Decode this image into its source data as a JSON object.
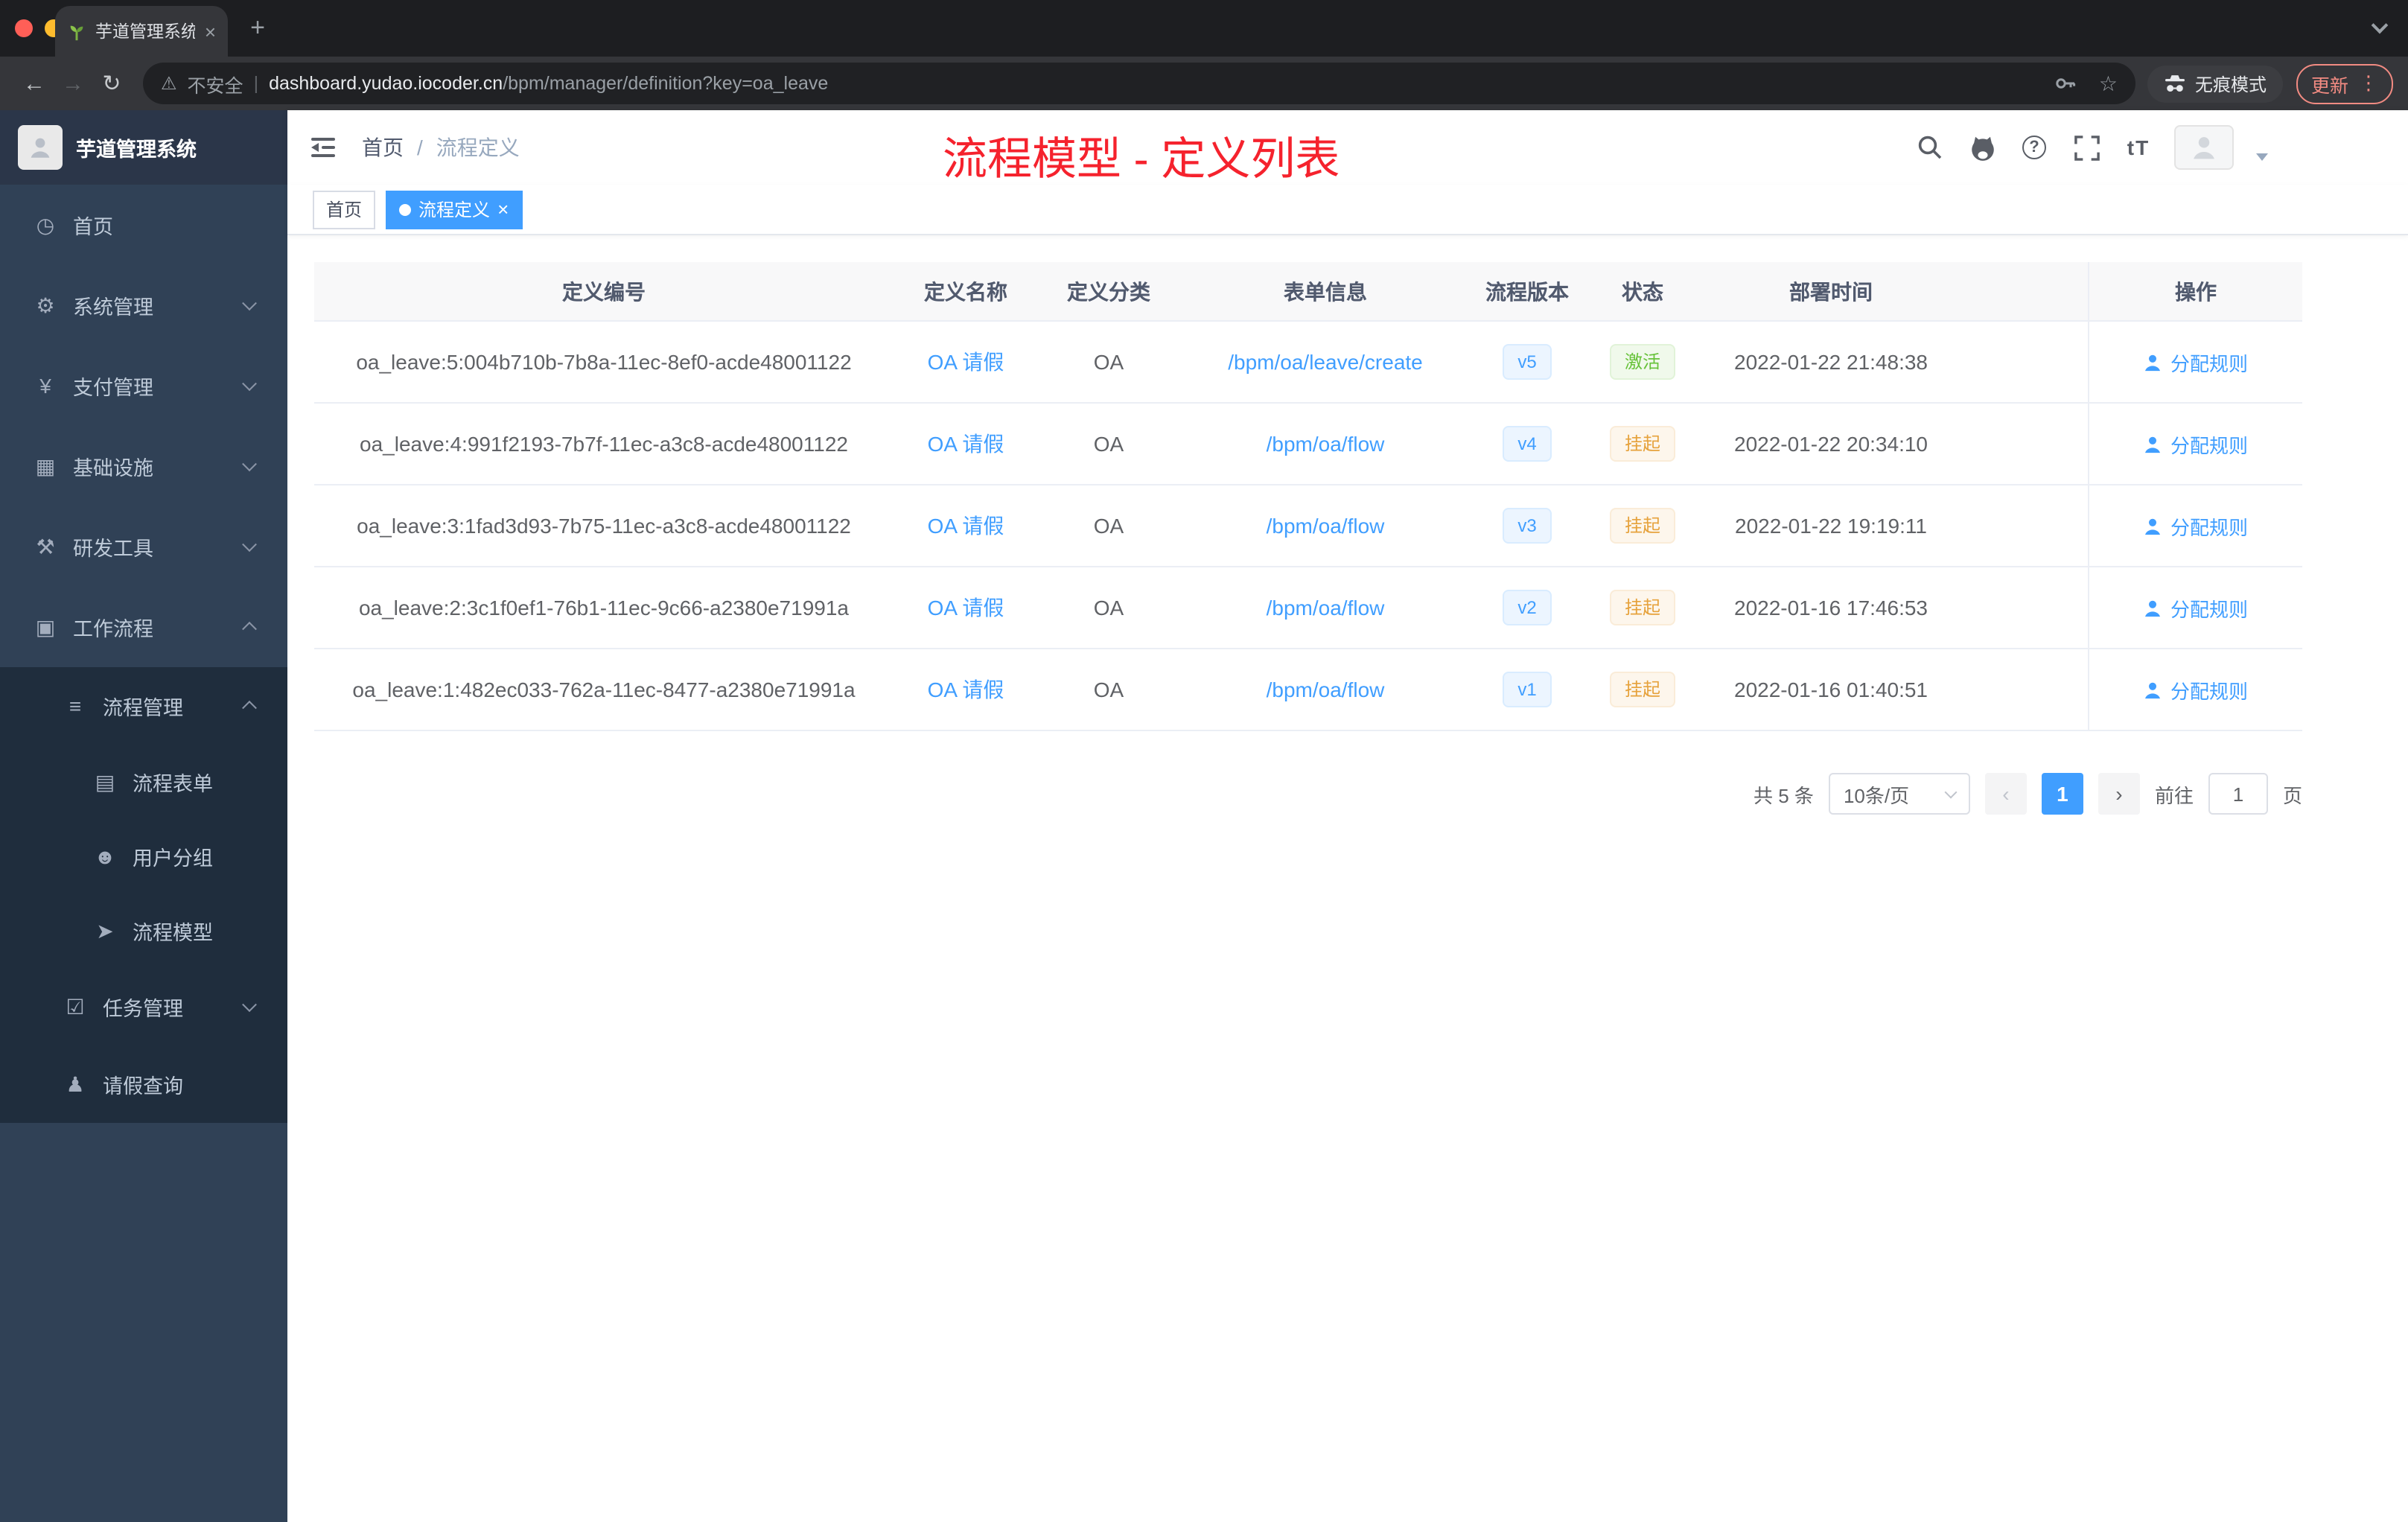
{
  "browser": {
    "tab_title": "芋道管理系统",
    "tab_close_glyph": "×",
    "new_tab_glyph": "+",
    "back_glyph": "←",
    "forward_glyph": "→",
    "reload_glyph": "↻",
    "warning_glyph": "⚠",
    "security_label": "不安全",
    "divider_glyph": "|",
    "url_domain": "dashboard.yudao.iocoder.cn",
    "url_path": "/bpm/manager/definition?key=oa_leave",
    "star_glyph": "☆",
    "incognito_label": "无痕模式",
    "update_label": "更新",
    "menu_dots_glyph": "⋮"
  },
  "sidebar": {
    "logo_title": "芋道管理系统",
    "menu": [
      {
        "label": "首页",
        "glyph": "◷"
      },
      {
        "label": "系统管理",
        "glyph": "⚙"
      },
      {
        "label": "支付管理",
        "glyph": "¥"
      },
      {
        "label": "基础设施",
        "glyph": "▦"
      },
      {
        "label": "研发工具",
        "glyph": "⚒"
      },
      {
        "label": "工作流程",
        "glyph": "▣"
      },
      {
        "label": "流程管理",
        "glyph": "≡"
      },
      {
        "label": "流程表单",
        "glyph": "▤"
      },
      {
        "label": "用户分组",
        "glyph": "☻"
      },
      {
        "label": "流程模型",
        "glyph": "➤"
      },
      {
        "label": "任务管理",
        "glyph": "☑"
      },
      {
        "label": "请假查询",
        "glyph": "♟"
      }
    ]
  },
  "header": {
    "breadcrumb_home": "首页",
    "breadcrumb_sep": "/",
    "breadcrumb_current": "流程定义",
    "font_size_tool": "tT",
    "question_glyph": "?"
  },
  "annotation": {
    "text": "流程模型 - 定义列表",
    "color": "#f5222d"
  },
  "tags": {
    "home": "首页",
    "active": "流程定义",
    "close_glyph": "×"
  },
  "table": {
    "columns": {
      "id": "定义编号",
      "name": "定义名称",
      "category": "定义分类",
      "form": "表单信息",
      "version": "流程版本",
      "status": "状态",
      "deploy_time": "部署时间",
      "action": "操作"
    },
    "rows": [
      {
        "id": "oa_leave:5:004b710b-7b8a-11ec-8ef0-acde48001122",
        "name": "OA 请假",
        "category": "OA",
        "form": "/bpm/oa/leave/create",
        "version": "v5",
        "status": "激活",
        "deploy_time": "2022-01-22 21:48:38",
        "action": "分配规则"
      },
      {
        "id": "oa_leave:4:991f2193-7b7f-11ec-a3c8-acde48001122",
        "name": "OA 请假",
        "category": "OA",
        "form": "/bpm/oa/flow",
        "version": "v4",
        "status": "挂起",
        "deploy_time": "2022-01-22 20:34:10",
        "action": "分配规则"
      },
      {
        "id": "oa_leave:3:1fad3d93-7b75-11ec-a3c8-acde48001122",
        "name": "OA 请假",
        "category": "OA",
        "form": "/bpm/oa/flow",
        "version": "v3",
        "status": "挂起",
        "deploy_time": "2022-01-22 19:19:11",
        "action": "分配规则"
      },
      {
        "id": "oa_leave:2:3c1f0ef1-76b1-11ec-9c66-a2380e71991a",
        "name": "OA 请假",
        "category": "OA",
        "form": "/bpm/oa/flow",
        "version": "v2",
        "status": "挂起",
        "deploy_time": "2022-01-16 17:46:53",
        "action": "分配规则"
      },
      {
        "id": "oa_leave:1:482ec033-762a-11ec-8477-a2380e71991a",
        "name": "OA 请假",
        "category": "OA",
        "form": "/bpm/oa/flow",
        "version": "v1",
        "status": "挂起",
        "deploy_time": "2022-01-16 01:40:51",
        "action": "分配规则"
      }
    ]
  },
  "pagination": {
    "total": "共 5 条",
    "page_size": "10条/页",
    "prev_glyph": "‹",
    "current_page": "1",
    "next_glyph": "›",
    "goto_label": "前往",
    "goto_value": "1",
    "unit": "页"
  },
  "colors": {
    "accent": "#409eff",
    "success": "#67c23a",
    "warning": "#e6a23c",
    "annotation": "#f5222d"
  }
}
